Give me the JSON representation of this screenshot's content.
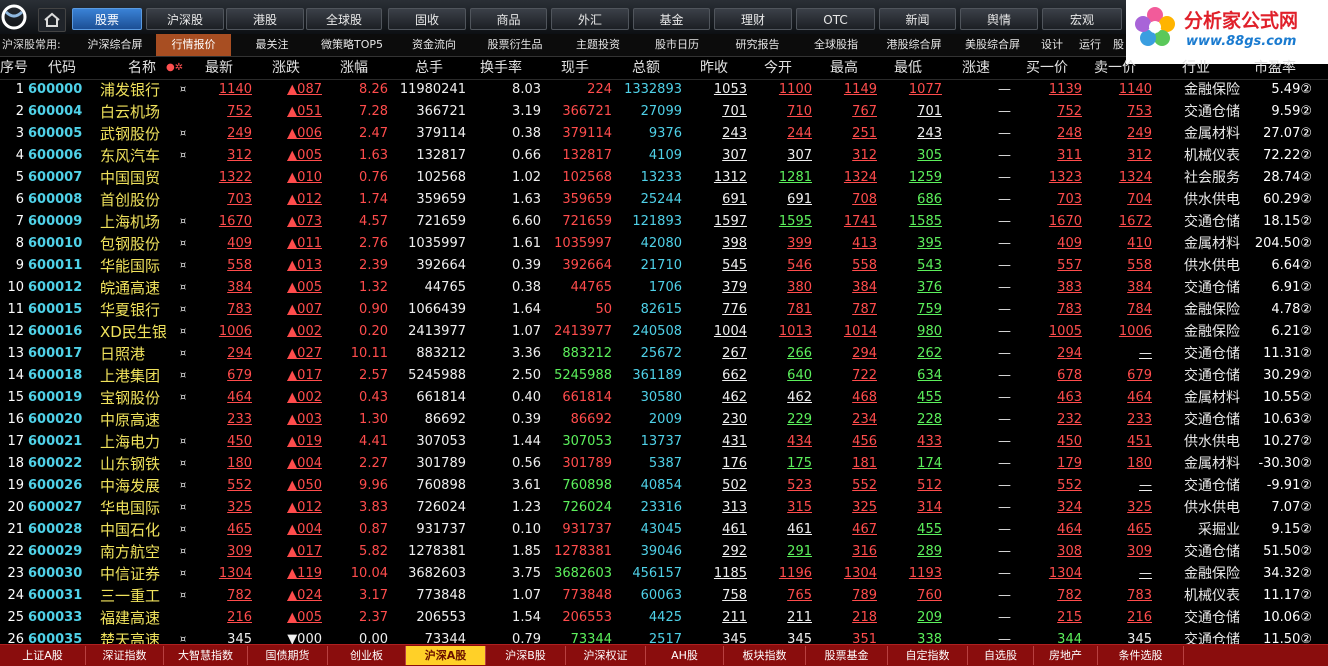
{
  "nav": {
    "tabs": [
      "股票",
      "沪深股",
      "港股",
      "全球股",
      "固收",
      "商品",
      "外汇",
      "基金",
      "理财",
      "OTC",
      "新闻",
      "舆情",
      "宏观"
    ],
    "active_index": 0
  },
  "brand": {
    "title": "分析家公式网",
    "url": "www.88gs.com"
  },
  "subnav": {
    "label": "沪深股常用:",
    "items": [
      "沪深综合屏",
      "行情报价",
      "最关注",
      "微策略TOP5",
      "资金流向",
      "股票衍生品",
      "主题投资",
      "股市日历",
      "研究报告",
      "全球股指",
      "港股综合屏",
      "美股综合屏",
      "设计",
      "运行",
      "股"
    ],
    "active_index": 1
  },
  "table": {
    "headers": [
      "序号",
      "代码",
      "名称",
      "最新",
      "涨跌",
      "涨幅",
      "总手",
      "换手率",
      "现手",
      "总额",
      "昨收",
      "今开",
      "最高",
      "最低",
      "涨速",
      "买一价",
      "卖一价",
      "行业",
      "市盈率"
    ],
    "name_header_mark": "●✲",
    "rows": [
      [
        "1",
        "600000",
        "浦发银行",
        "¤",
        "1140",
        "▲087",
        "8.26",
        "11980241",
        "8.03",
        "224",
        "1332893",
        "1053",
        "1100",
        "1149",
        "1077",
        "—",
        "1139",
        "1140",
        "金融保险",
        "5.49"
      ],
      [
        "2",
        "600004",
        "白云机场",
        "",
        "752",
        "▲051",
        "7.28",
        "366721",
        "3.19",
        "366721",
        "27099",
        "701",
        "710",
        "767",
        "701",
        "—",
        "752",
        "753",
        "交通仓储",
        "9.59"
      ],
      [
        "3",
        "600005",
        "武钢股份",
        "¤",
        "249",
        "▲006",
        "2.47",
        "379114",
        "0.38",
        "379114",
        "9376",
        "243",
        "244",
        "251",
        "243",
        "—",
        "248",
        "249",
        "金属材料",
        "27.07"
      ],
      [
        "4",
        "600006",
        "东风汽车",
        "¤",
        "312",
        "▲005",
        "1.63",
        "132817",
        "0.66",
        "132817",
        "4109",
        "307",
        "307",
        "312",
        "305",
        "—",
        "311",
        "312",
        "机械仪表",
        "72.22"
      ],
      [
        "5",
        "600007",
        "中国国贸",
        "",
        "1322",
        "▲010",
        "0.76",
        "102568",
        "1.02",
        "102568",
        "13233",
        "1312",
        "1281",
        "1324",
        "1259",
        "—",
        "1323",
        "1324",
        "社会服务",
        "28.74"
      ],
      [
        "6",
        "600008",
        "首创股份",
        "",
        "703",
        "▲012",
        "1.74",
        "359659",
        "1.63",
        "359659",
        "25244",
        "691",
        "691",
        "708",
        "686",
        "—",
        "703",
        "704",
        "供水供电",
        "60.29"
      ],
      [
        "7",
        "600009",
        "上海机场",
        "¤",
        "1670",
        "▲073",
        "4.57",
        "721659",
        "6.60",
        "721659",
        "121893",
        "1597",
        "1595",
        "1741",
        "1585",
        "—",
        "1670",
        "1672",
        "交通仓储",
        "18.15"
      ],
      [
        "8",
        "600010",
        "包钢股份",
        "¤",
        "409",
        "▲011",
        "2.76",
        "1035997",
        "1.61",
        "1035997",
        "42080",
        "398",
        "399",
        "413",
        "395",
        "—",
        "409",
        "410",
        "金属材料",
        "204.50"
      ],
      [
        "9",
        "600011",
        "华能国际",
        "¤",
        "558",
        "▲013",
        "2.39",
        "392664",
        "0.39",
        "392664",
        "21710",
        "545",
        "546",
        "558",
        "543",
        "—",
        "557",
        "558",
        "供水供电",
        "6.64"
      ],
      [
        "10",
        "600012",
        "皖通高速",
        "¤",
        "384",
        "▲005",
        "1.32",
        "44765",
        "0.38",
        "44765",
        "1706",
        "379",
        "380",
        "384",
        "376",
        "—",
        "383",
        "384",
        "交通仓储",
        "6.91"
      ],
      [
        "11",
        "600015",
        "华夏银行",
        "¤",
        "783",
        "▲007",
        "0.90",
        "1066439",
        "1.64",
        "50",
        "82615",
        "776",
        "781",
        "787",
        "759",
        "—",
        "783",
        "784",
        "金融保险",
        "4.78"
      ],
      [
        "12",
        "600016",
        "XD民生银",
        "¤",
        "1006",
        "▲002",
        "0.20",
        "2413977",
        "1.07",
        "2413977",
        "240508",
        "1004",
        "1013",
        "1014",
        "980",
        "—",
        "1005",
        "1006",
        "金融保险",
        "6.21"
      ],
      [
        "13",
        "600017",
        "日照港",
        "¤",
        "294",
        "▲027",
        "10.11",
        "883212",
        "3.36",
        "883212",
        "25672",
        "267",
        "266",
        "294",
        "262",
        "—",
        "294",
        "—",
        "交通仓储",
        "11.31"
      ],
      [
        "14",
        "600018",
        "上港集团",
        "¤",
        "679",
        "▲017",
        "2.57",
        "5245988",
        "2.50",
        "5245988",
        "361189",
        "662",
        "640",
        "722",
        "634",
        "—",
        "678",
        "679",
        "交通仓储",
        "30.29"
      ],
      [
        "15",
        "600019",
        "宝钢股份",
        "¤",
        "464",
        "▲002",
        "0.43",
        "661814",
        "0.40",
        "661814",
        "30580",
        "462",
        "462",
        "468",
        "455",
        "—",
        "463",
        "464",
        "金属材料",
        "10.55"
      ],
      [
        "16",
        "600020",
        "中原高速",
        "",
        "233",
        "▲003",
        "1.30",
        "86692",
        "0.39",
        "86692",
        "2009",
        "230",
        "229",
        "234",
        "228",
        "—",
        "232",
        "233",
        "交通仓储",
        "10.63"
      ],
      [
        "17",
        "600021",
        "上海电力",
        "¤",
        "450",
        "▲019",
        "4.41",
        "307053",
        "1.44",
        "307053",
        "13737",
        "431",
        "434",
        "456",
        "433",
        "—",
        "450",
        "451",
        "供水供电",
        "10.27"
      ],
      [
        "18",
        "600022",
        "山东钢铁",
        "¤",
        "180",
        "▲004",
        "2.27",
        "301789",
        "0.56",
        "301789",
        "5387",
        "176",
        "175",
        "181",
        "174",
        "—",
        "179",
        "180",
        "金属材料",
        "-30.30"
      ],
      [
        "19",
        "600026",
        "中海发展",
        "¤",
        "552",
        "▲050",
        "9.96",
        "760898",
        "3.61",
        "760898",
        "40854",
        "502",
        "523",
        "552",
        "512",
        "—",
        "552",
        "—",
        "交通仓储",
        "-9.91"
      ],
      [
        "20",
        "600027",
        "华电国际",
        "¤",
        "325",
        "▲012",
        "3.83",
        "726024",
        "1.23",
        "726024",
        "23316",
        "313",
        "315",
        "325",
        "314",
        "—",
        "324",
        "325",
        "供水供电",
        "7.07"
      ],
      [
        "21",
        "600028",
        "中国石化",
        "¤",
        "465",
        "▲004",
        "0.87",
        "931737",
        "0.10",
        "931737",
        "43045",
        "461",
        "461",
        "467",
        "455",
        "—",
        "464",
        "465",
        "采掘业",
        "9.15"
      ],
      [
        "22",
        "600029",
        "南方航空",
        "¤",
        "309",
        "▲017",
        "5.82",
        "1278381",
        "1.85",
        "1278381",
        "39046",
        "292",
        "291",
        "316",
        "289",
        "—",
        "308",
        "309",
        "交通仓储",
        "51.50"
      ],
      [
        "23",
        "600030",
        "中信证券",
        "¤",
        "1304",
        "▲119",
        "10.04",
        "3682603",
        "3.75",
        "3682603",
        "456157",
        "1185",
        "1196",
        "1304",
        "1193",
        "—",
        "1304",
        "—",
        "金融保险",
        "34.32"
      ],
      [
        "24",
        "600031",
        "三一重工",
        "¤",
        "782",
        "▲024",
        "3.17",
        "773848",
        "1.07",
        "773848",
        "60063",
        "758",
        "765",
        "789",
        "760",
        "—",
        "782",
        "783",
        "机械仪表",
        "11.17"
      ],
      [
        "25",
        "600033",
        "福建高速",
        "",
        "216",
        "▲005",
        "2.37",
        "206553",
        "1.54",
        "206553",
        "4425",
        "211",
        "211",
        "218",
        "209",
        "—",
        "215",
        "216",
        "交通仓储",
        "10.06"
      ],
      [
        "26",
        "600035",
        "楚天高速",
        "¤",
        "345",
        "▼000",
        "0.00",
        "73344",
        "0.79",
        "73344",
        "2517",
        "345",
        "345",
        "351",
        "338",
        "—",
        "344",
        "345",
        "交通仓储",
        "11.50"
      ]
    ],
    "color_classes": {
      "latest": "up",
      "change": "up",
      "pct": "up",
      "now": "up"
    },
    "pe_suffix": "②"
  },
  "bottom": {
    "tabs": [
      "上证A股",
      "深证指数",
      "大智慧指数",
      "国债期货",
      "创业板",
      "沪深A股",
      "沪深B股",
      "沪深权证",
      "AH股",
      "板块指数",
      "股票基金",
      "自定指数",
      "自选股",
      "房地产",
      "条件选股"
    ],
    "active_index": 5
  },
  "colors": {
    "up": "#ff4c4c",
    "down": "#5cf05c",
    "code": "#4fd1e8",
    "name": "#f0e25c",
    "active_tab": "#2f73c4",
    "bottom_bar": "#8a0d0d"
  }
}
